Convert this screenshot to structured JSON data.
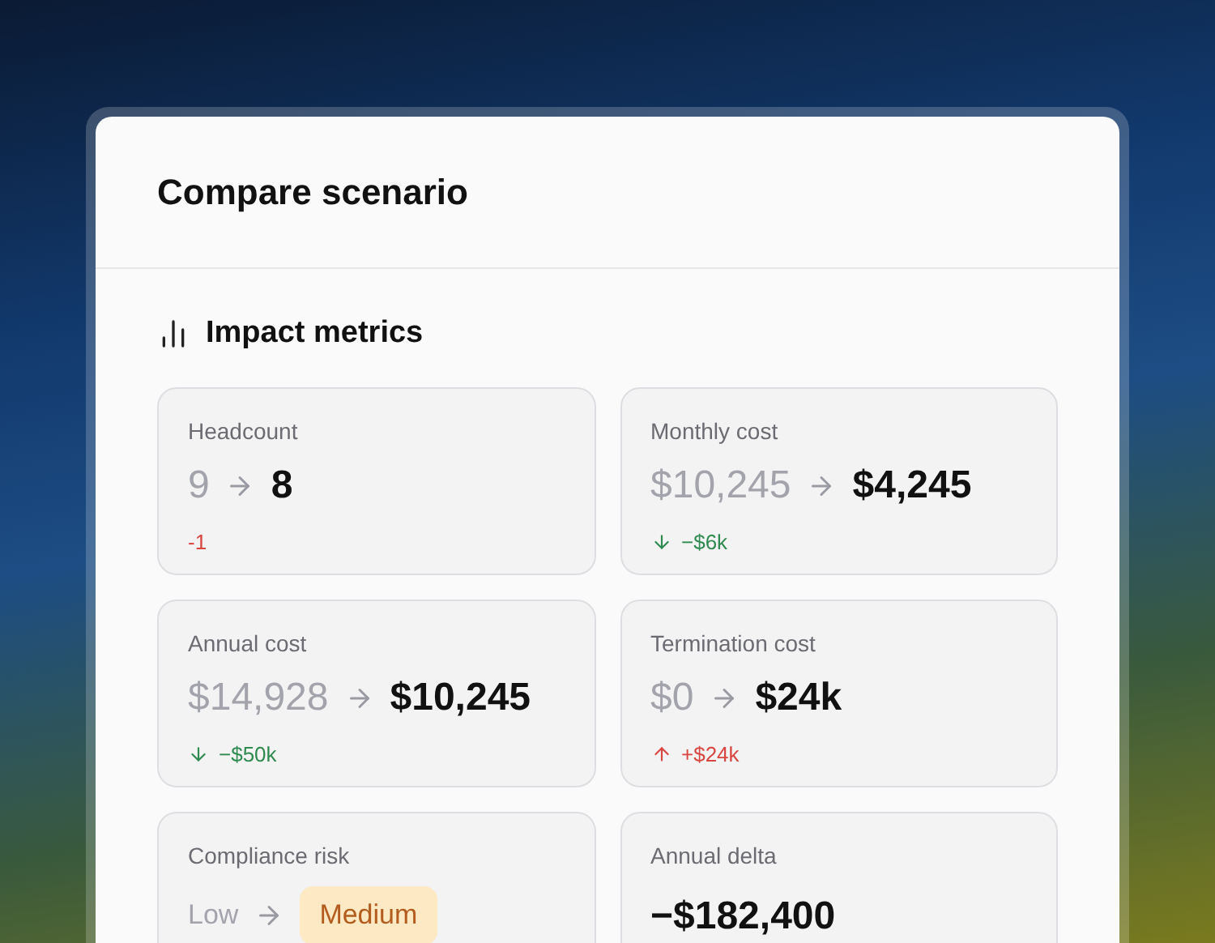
{
  "dialog": {
    "title": "Compare scenario"
  },
  "section": {
    "title": "Impact metrics"
  },
  "metrics": [
    {
      "kind": "change",
      "label": "Headcount",
      "from": "9",
      "to": "8",
      "delta": {
        "kind": "plain",
        "text": "-1",
        "color": "#d9453f"
      }
    },
    {
      "kind": "change",
      "label": "Monthly cost",
      "from": "$10,245",
      "to": "$4,245",
      "delta": {
        "kind": "down",
        "text": "−$6k",
        "color": "#2f8a4f"
      }
    },
    {
      "kind": "change",
      "label": "Annual cost",
      "from": "$14,928",
      "to": "$10,245",
      "delta": {
        "kind": "down",
        "text": "−$50k",
        "color": "#2f8a4f"
      }
    },
    {
      "kind": "change",
      "label": "Termination cost",
      "from": "$0",
      "to": "$24k",
      "delta": {
        "kind": "up",
        "text": "+$24k",
        "color": "#d9453f"
      }
    },
    {
      "kind": "badge",
      "label": "Compliance risk",
      "from": "Low",
      "to": "Medium"
    },
    {
      "kind": "single",
      "label": "Annual delta",
      "value": "−$182,400"
    }
  ]
}
